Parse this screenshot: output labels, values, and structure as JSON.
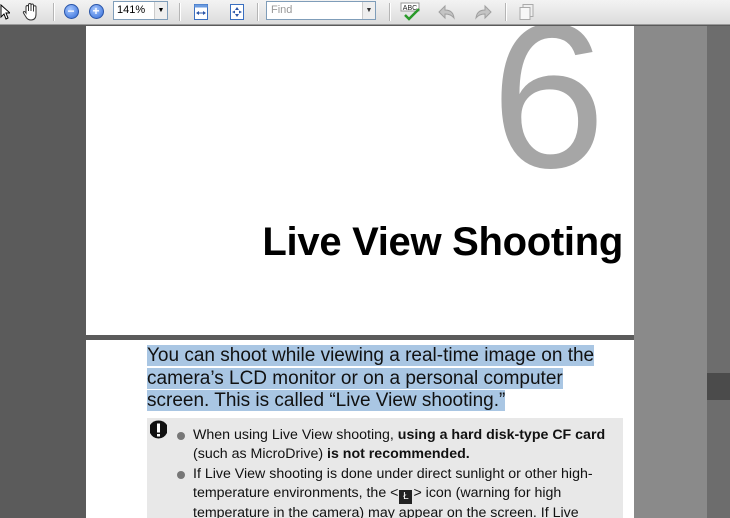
{
  "toolbar": {
    "zoom_level": "141%",
    "find_placeholder": "Find",
    "spellcheck_label": "ABC"
  },
  "page1": {
    "chapter_number": "6",
    "chapter_title": "Live View Shooting"
  },
  "page2": {
    "intro_text": "You can shoot while viewing a real-time image on the camera’s LCD monitor or on a personal computer screen. This is called “Live View shooting.”",
    "bullets": [
      {
        "t1": "When using Live View shooting, ",
        "b1": "using a hard disk-type CF card",
        "t2": " (such as MicroDrive) ",
        "b2": "is not recommended."
      },
      {
        "t1": "If Live View shooting is done under direct sunlight or other high-temperature environments, the <",
        "icon": "Ł",
        "t2": "> icon (warning for high temperature in the camera) may appear on the screen. If Live"
      }
    ]
  },
  "colors": {
    "highlight": "#a9c6e3",
    "chapter_number": "#a6a6a6",
    "notice_bg": "#e8e8e8"
  }
}
